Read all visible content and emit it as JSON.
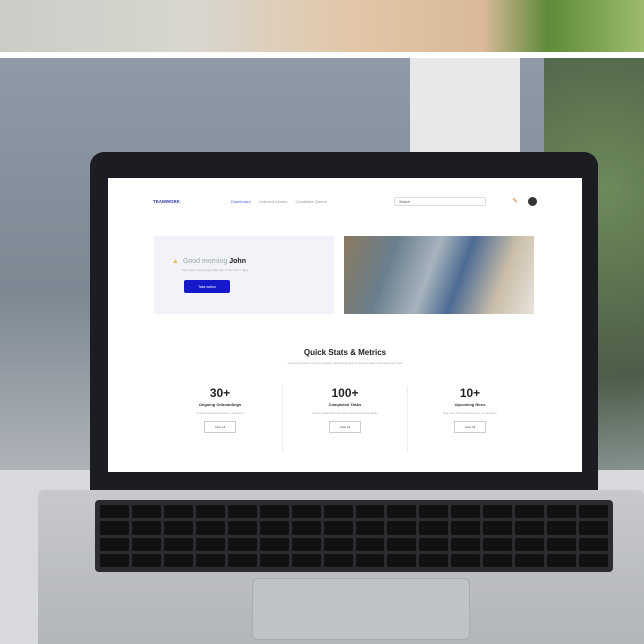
{
  "nav": {
    "logo": "TEAMWORK",
    "items": [
      "Dashboard",
      "Onboard Library",
      "Candidate Queue"
    ],
    "search_placeholder": "Search"
  },
  "hero": {
    "greeting": "Good morning",
    "name": "John",
    "subtitle": "You have onboarding tasks due in the next 7 days",
    "cta": "Take action"
  },
  "stats": {
    "title": "Quick Stats & Metrics",
    "description": "A quick overview of your ongoing onboarding and completed tasks and upcoming hires",
    "items": [
      {
        "value": "30+",
        "label": "Ongoing Onboardings",
        "description": "Track onboarding that's in progress",
        "button": "View All"
      },
      {
        "value": "100+",
        "label": "Completed Tasks",
        "description": "Check tasks that have been finished successfully",
        "button": "View All"
      },
      {
        "value": "10+",
        "label": "Upcoming Hires",
        "description": "See new hires starting soon on the team",
        "button": "View All"
      }
    ]
  }
}
